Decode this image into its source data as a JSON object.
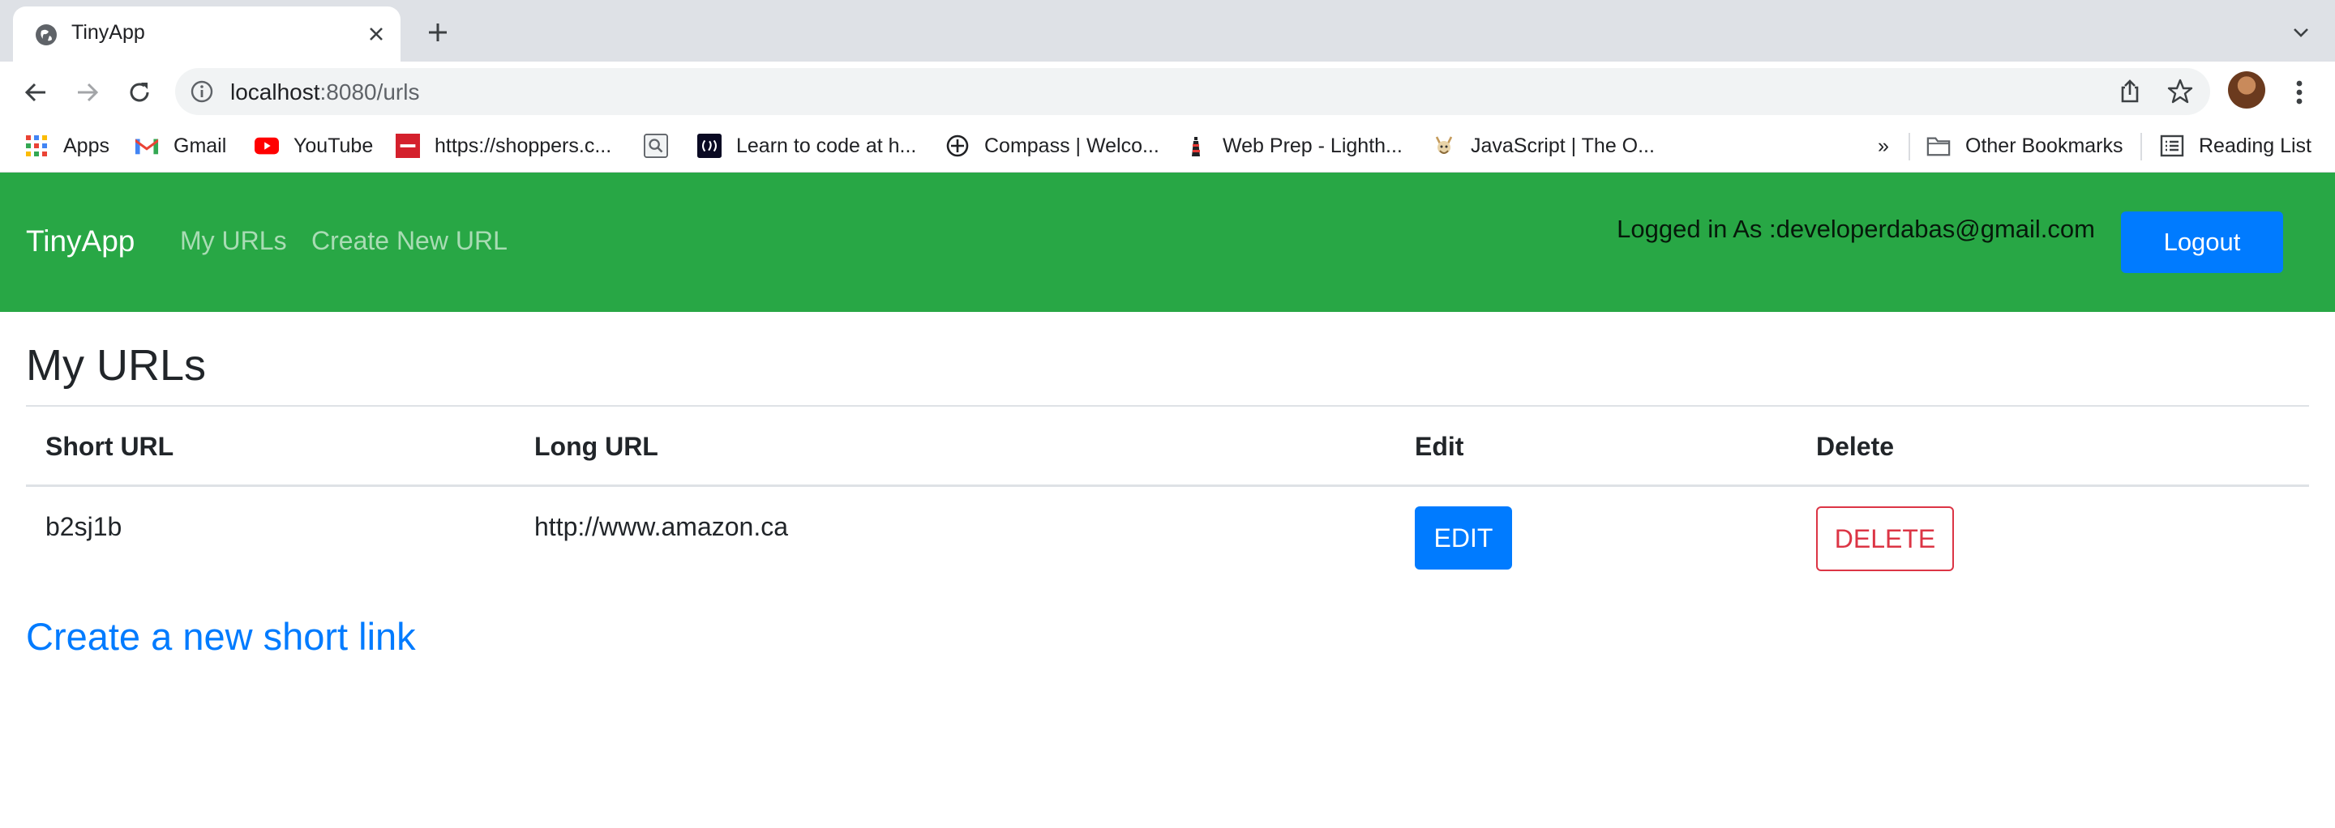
{
  "browser": {
    "tab_title": "TinyApp",
    "url_host": "localhost",
    "url_rest": ":8080/urls",
    "bookmarks": [
      {
        "label": "Apps",
        "icon": "apps-grid-icon"
      },
      {
        "label": "Gmail",
        "icon": "gmail-icon"
      },
      {
        "label": "YouTube",
        "icon": "youtube-icon"
      },
      {
        "label": "https://shoppers.c...",
        "icon": "infor-icon"
      },
      {
        "label": "",
        "icon": "search-bookmark-icon"
      },
      {
        "label": "Learn to code at h...",
        "icon": "freecodecamp-icon"
      },
      {
        "label": "Compass | Welco...",
        "icon": "compass-icon"
      },
      {
        "label": "Web Prep - Lighth...",
        "icon": "lighthouse-icon"
      },
      {
        "label": "JavaScript | The O...",
        "icon": "javascript-odin-icon"
      }
    ],
    "overflow": "»",
    "other_bookmarks": "Other Bookmarks",
    "reading_list": "Reading List"
  },
  "app": {
    "brand": "TinyApp",
    "nav_my_urls": "My URLs",
    "nav_create": "Create New URL",
    "logged_in": "Logged in As :developerdabas@gmail.com",
    "logout": "Logout",
    "colors": {
      "navbar": "#28a745",
      "primary": "#007bff",
      "danger": "#dc3545"
    }
  },
  "main": {
    "title": "My URLs",
    "headers": {
      "short": "Short URL",
      "long": "Long URL",
      "edit": "Edit",
      "delete": "Delete"
    },
    "rows": [
      {
        "short": "b2sj1b",
        "long": "http://www.amazon.ca",
        "edit": "EDIT",
        "delete": "DELETE"
      }
    ],
    "create_link": "Create a new short link"
  }
}
